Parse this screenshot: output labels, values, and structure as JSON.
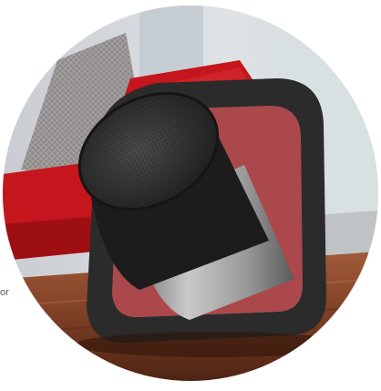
{
  "fragment": {
    "text": "or"
  },
  "photo": {
    "subject": "speaker-photo",
    "colors": {
      "sofa": "#c4161c",
      "frame": "#2b2b2b",
      "grille": "#3a3a3a",
      "body_silver": "#a8a8a8",
      "table": "#8a4a2c"
    }
  }
}
